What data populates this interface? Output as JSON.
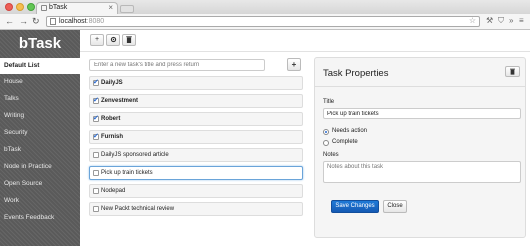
{
  "browser": {
    "tab_title": "bTask",
    "url_host": "localhost",
    "url_port": ":8080"
  },
  "sidebar": {
    "brand": "bTask",
    "items": [
      {
        "label": "Default List",
        "active": true
      },
      {
        "label": "House"
      },
      {
        "label": "Talks"
      },
      {
        "label": "Writing"
      },
      {
        "label": "Security"
      },
      {
        "label": "bTask"
      },
      {
        "label": "Node in Practice"
      },
      {
        "label": "Open Source"
      },
      {
        "label": "Work"
      },
      {
        "label": "Events Feedback"
      }
    ]
  },
  "toolbar": {
    "add_icon": "+",
    "settings_icon": "gear-icon",
    "delete_icon": "trash-icon"
  },
  "new_task": {
    "placeholder": "Enter a new task's title and press return",
    "add_button_label": "+"
  },
  "tasks": [
    {
      "title": "DailyJS",
      "done": true
    },
    {
      "title": "Zenvestment",
      "done": true
    },
    {
      "title": "Robert",
      "done": true
    },
    {
      "title": "Furnish",
      "done": true
    },
    {
      "title": "DailyJS sponsored article",
      "done": false
    },
    {
      "title": "Pick up train tickets",
      "done": false,
      "selected": true
    },
    {
      "title": "Nodepad",
      "done": false
    },
    {
      "title": "New Packt technical review",
      "done": false
    }
  ],
  "properties": {
    "heading": "Task Properties",
    "title_label": "Title",
    "title_value": "Pick up train tickets",
    "status_options": [
      "Needs action",
      "Complete"
    ],
    "status_selected": "Needs action",
    "notes_label": "Notes",
    "notes_placeholder": "Notes about this task",
    "save_label": "Save Changes",
    "close_label": "Close"
  },
  "colors": {
    "primary": "#1f6fd0",
    "sidebar_bg": "#5f5f5f"
  }
}
